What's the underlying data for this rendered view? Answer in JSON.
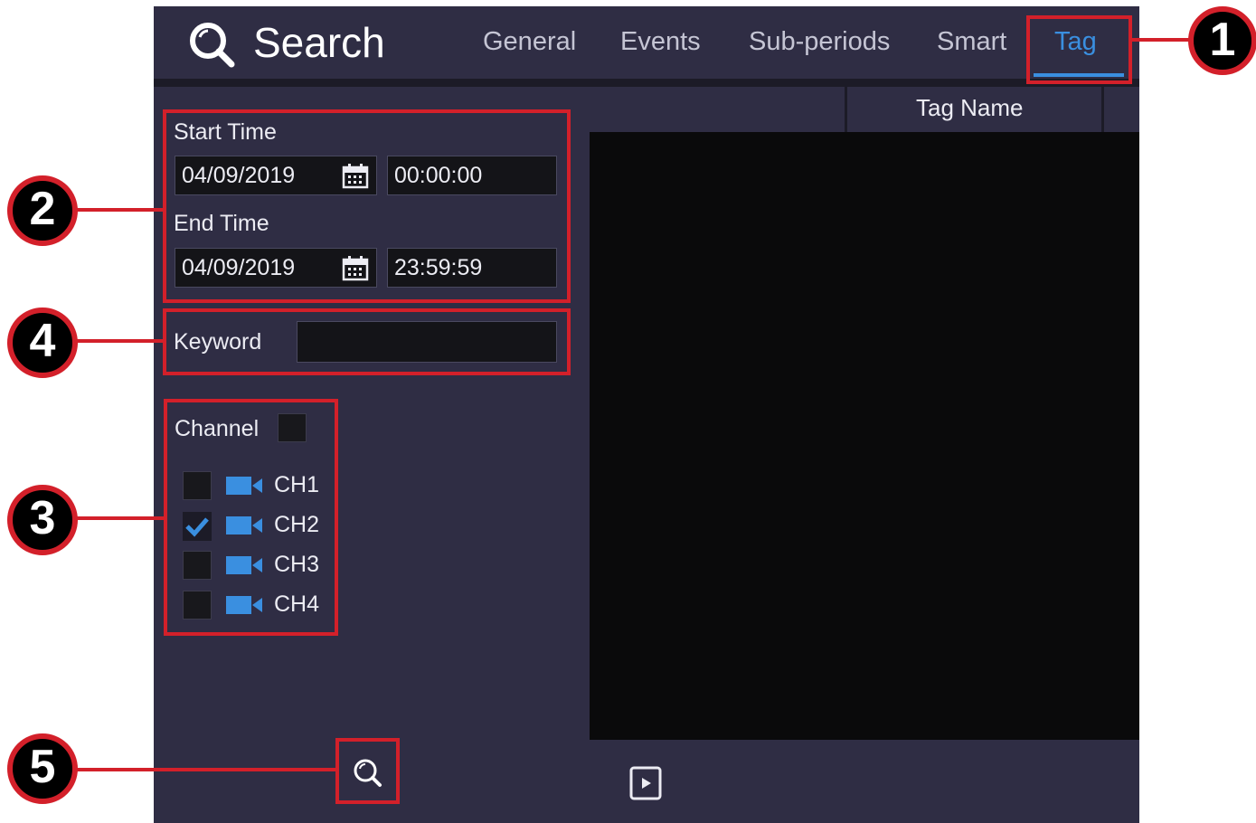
{
  "header": {
    "title": "Search",
    "tabs": [
      {
        "label": "General"
      },
      {
        "label": "Events"
      },
      {
        "label": "Sub-periods"
      },
      {
        "label": "Smart"
      },
      {
        "label": "Tag",
        "active": true
      }
    ]
  },
  "filters": {
    "start_time_label": "Start Time",
    "start_date": "04/09/2019",
    "start_time": "00:00:00",
    "end_time_label": "End Time",
    "end_date": "04/09/2019",
    "end_time": "23:59:59",
    "keyword_label": "Keyword",
    "keyword_value": "",
    "channel_label": "Channel",
    "channel_all_checked": false,
    "channels": [
      {
        "label": "CH1",
        "checked": false
      },
      {
        "label": "CH2",
        "checked": true
      },
      {
        "label": "CH3",
        "checked": false
      },
      {
        "label": "CH4",
        "checked": false
      }
    ]
  },
  "results": {
    "columns": [
      "",
      "Tag Name",
      ""
    ]
  },
  "callouts": {
    "tag_tab": "1",
    "time_range": "2",
    "channels": "3",
    "keyword": "4",
    "search_button": "5"
  },
  "colors": {
    "accent": "#3a8fe0",
    "panel": "#2f2d44",
    "callout_red": "#d3202a"
  }
}
